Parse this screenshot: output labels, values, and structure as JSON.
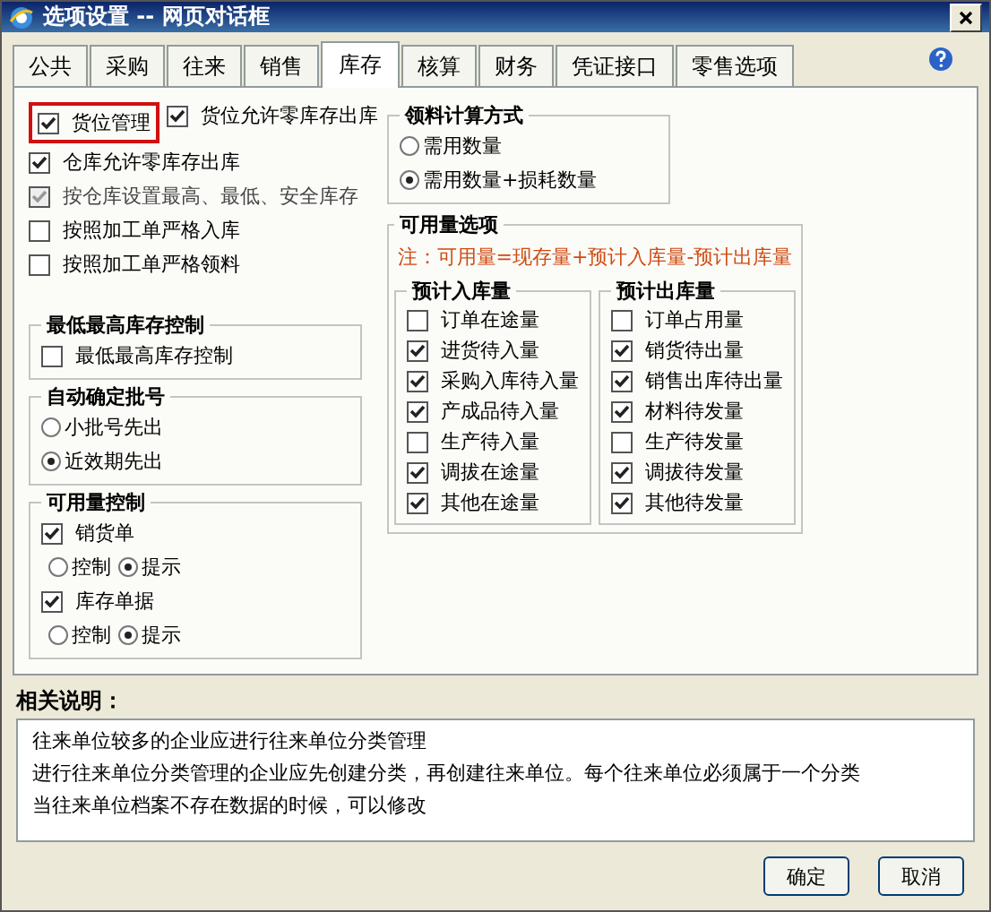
{
  "window": {
    "title": "选项设置 -- 网页对话框"
  },
  "tabs": [
    {
      "label": "公共",
      "selected": false
    },
    {
      "label": "采购",
      "selected": false
    },
    {
      "label": "往来",
      "selected": false
    },
    {
      "label": "销售",
      "selected": false
    },
    {
      "label": "库存",
      "selected": true
    },
    {
      "label": "核算",
      "selected": false
    },
    {
      "label": "财务",
      "selected": false
    },
    {
      "label": "凭证接口",
      "selected": false
    },
    {
      "label": "零售选项",
      "selected": false
    }
  ],
  "top_row": [
    {
      "label": "货位管理",
      "checked": true,
      "disabled": false,
      "highlighted": true
    },
    {
      "label": "货位允许零库存出库",
      "checked": true,
      "disabled": false,
      "highlighted": false
    }
  ],
  "options": [
    {
      "label": "仓库允许零库存出库",
      "checked": true,
      "disabled": false
    },
    {
      "label": "按仓库设置最高、最低、安全库存",
      "checked": true,
      "disabled": true
    },
    {
      "label": "按照加工单严格入库",
      "checked": false,
      "disabled": false
    },
    {
      "label": "按照加工单严格领料",
      "checked": false,
      "disabled": false
    }
  ],
  "min_max": {
    "title": "最低最高库存控制",
    "options": [
      {
        "label": "最低最高库存控制",
        "checked": false
      }
    ]
  },
  "batch": {
    "title": "自动确定批号",
    "radios": [
      {
        "label": "小批号先出",
        "selected": false
      },
      {
        "label": "近效期先出",
        "selected": true
      }
    ]
  },
  "availability_control": {
    "title": "可用量控制",
    "items": [
      {
        "label": "销货单",
        "checked": true,
        "radios": [
          {
            "label": "控制",
            "selected": false
          },
          {
            "label": "提示",
            "selected": true
          }
        ]
      },
      {
        "label": "库存单据",
        "checked": true,
        "radios": [
          {
            "label": "控制",
            "selected": false
          },
          {
            "label": "提示",
            "selected": true
          }
        ]
      }
    ]
  },
  "material_calc": {
    "title": "领料计算方式",
    "radios": [
      {
        "label": "需用数量",
        "selected": false
      },
      {
        "label": "需用数量+损耗数量",
        "selected": true
      }
    ]
  },
  "availability_options": {
    "title": "可用量选项",
    "note": "注：可用量=现存量+预计入库量-预计出库量",
    "inbound": {
      "title": "预计入库量",
      "options": [
        {
          "label": "订单在途量",
          "checked": false
        },
        {
          "label": "进货待入量",
          "checked": true
        },
        {
          "label": "采购入库待入量",
          "checked": true
        },
        {
          "label": "产成品待入量",
          "checked": true
        },
        {
          "label": "生产待入量",
          "checked": false
        },
        {
          "label": "调拔在途量",
          "checked": true
        },
        {
          "label": "其他在途量",
          "checked": true
        }
      ]
    },
    "outbound": {
      "title": "预计出库量",
      "options": [
        {
          "label": "订单占用量",
          "checked": false
        },
        {
          "label": "销货待出量",
          "checked": true
        },
        {
          "label": "销售出库待出量",
          "checked": true
        },
        {
          "label": "材料待发量",
          "checked": true
        },
        {
          "label": "生产待发量",
          "checked": false
        },
        {
          "label": "调拔待发量",
          "checked": true
        },
        {
          "label": "其他待发量",
          "checked": true
        }
      ]
    }
  },
  "description": {
    "title": "相关说明：",
    "lines": [
      "往来单位较多的企业应进行往来单位分类管理",
      "进行往来单位分类管理的企业应先创建分类，再创建往来单位。每个往来单位必须属于一个分类",
      "当往来单位档案不存在数据的时候，可以修改"
    ]
  },
  "buttons": [
    "确定",
    "取消"
  ]
}
